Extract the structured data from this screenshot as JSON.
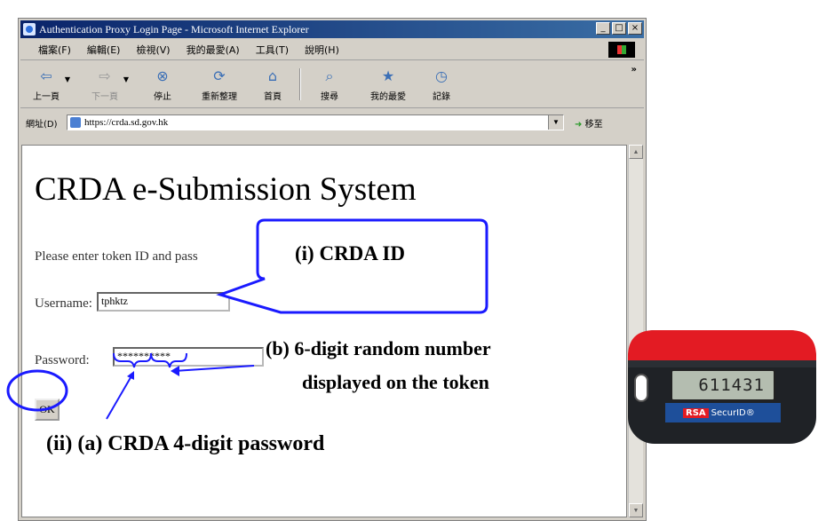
{
  "window": {
    "title": "Authentication Proxy Login Page - Microsoft Internet Explorer",
    "controls": [
      "_",
      "□",
      "×"
    ]
  },
  "menu": [
    "檔案(F)",
    "編輯(E)",
    "檢視(V)",
    "我的最愛(A)",
    "工具(T)",
    "說明(H)"
  ],
  "toolbar": {
    "back": "上一頁",
    "forward": "下一頁",
    "stop": "停止",
    "refresh": "重新整理",
    "home": "首頁",
    "search": "搜尋",
    "favorites": "我的最愛",
    "history": "記錄",
    "overflow": "»"
  },
  "address": {
    "label": "網址(D)",
    "url": "https://crda.sd.gov.hk",
    "go_label": "移至"
  },
  "page": {
    "heading": "CRDA e-Submission System",
    "instruction": "Please enter token ID and pass",
    "username_label": "Username:",
    "username_value": "tphktz",
    "password_label": "Password:",
    "password_value": "**********",
    "ok_label": "OK"
  },
  "annotations": {
    "crda_id": "(i) CRDA ID",
    "token_number_line1": "(b) 6-digit random number",
    "token_number_line2": "displayed on the token",
    "crda_password": "(ii) (a) CRDA 4-digit password"
  },
  "token": {
    "display": "611431",
    "brand": "RSA",
    "product": "SecurID®"
  },
  "colors": {
    "annotation_blue": "#1a1aff",
    "title_gradient_start": "#0a246a",
    "title_gradient_end": "#3a6ea5",
    "token_red": "#e31b23",
    "token_body": "#1f2226"
  }
}
